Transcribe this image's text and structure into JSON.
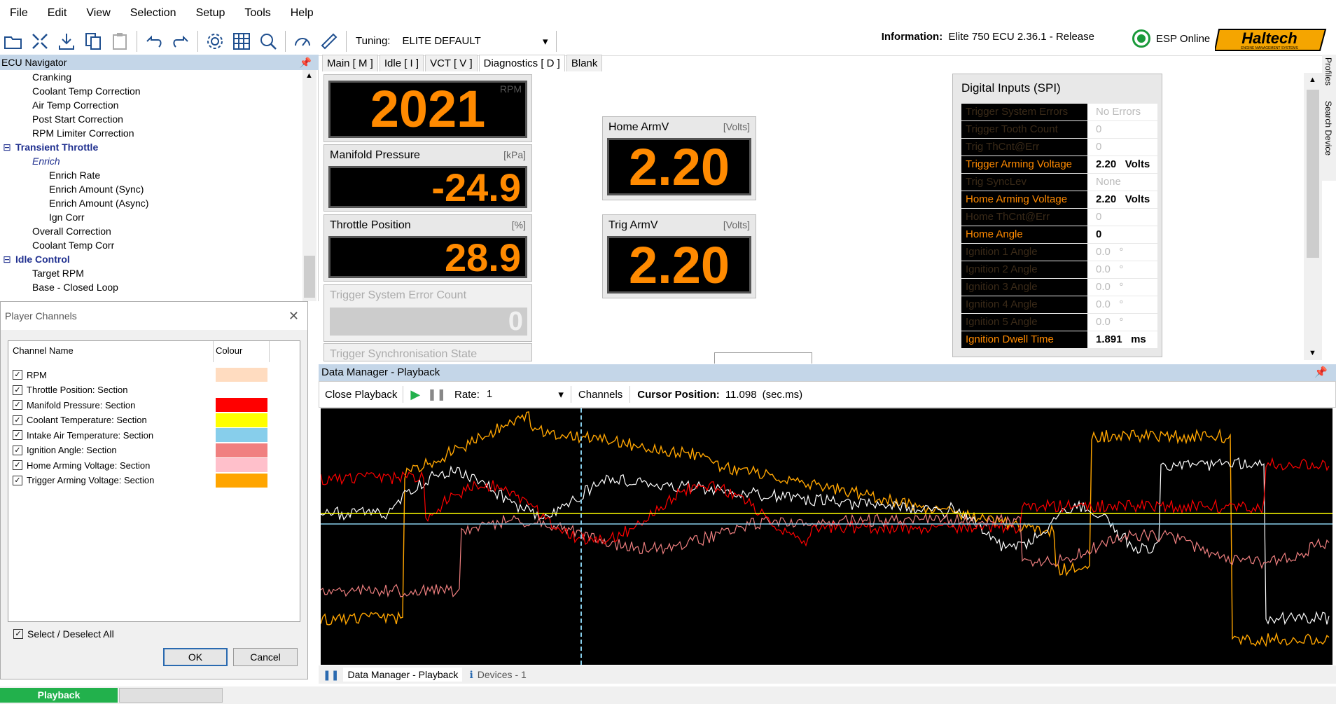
{
  "menu": [
    "File",
    "Edit",
    "View",
    "Selection",
    "Setup",
    "Tools",
    "Help"
  ],
  "toolbar": {
    "tuning_label": "Tuning:",
    "tuning_value": "ELITE DEFAULT"
  },
  "info": {
    "label": "Information:",
    "value": "Elite 750 ECU 2.36.1 - Release"
  },
  "esp": {
    "label": "ESP Online",
    "color": "#1a9a3a"
  },
  "logo": {
    "text": "Haltech",
    "sub": "ENGINE MANAGEMENT SYSTEMS"
  },
  "navigator": {
    "title": "ECU Navigator",
    "items": [
      {
        "label": "Cranking",
        "style": "normal"
      },
      {
        "label": "Coolant Temp Correction",
        "style": "normal"
      },
      {
        "label": "Air Temp Correction",
        "style": "normal"
      },
      {
        "label": "Post Start Correction",
        "style": "normal"
      },
      {
        "label": "RPM Limiter Correction",
        "style": "normal"
      },
      {
        "label": "Transient Throttle",
        "style": "bold"
      },
      {
        "label": "Enrich",
        "style": "italic"
      },
      {
        "label": "Enrich Rate",
        "style": "normal"
      },
      {
        "label": "Enrich Amount (Sync)",
        "style": "normal"
      },
      {
        "label": "Enrich Amount (Async)",
        "style": "normal"
      },
      {
        "label": "Ign Corr",
        "style": "normal"
      },
      {
        "label": "Overall Correction",
        "style": "normal"
      },
      {
        "label": "Coolant Temp Corr",
        "style": "normal"
      },
      {
        "label": "Idle Control",
        "style": "bold"
      },
      {
        "label": "Target RPM",
        "style": "normal"
      },
      {
        "label": "Base - Closed Loop",
        "style": "normal"
      }
    ]
  },
  "player_channels": {
    "title": "Player Channels",
    "col_name": "Channel Name",
    "col_colour": "Colour",
    "channels": [
      {
        "name": "RPM",
        "color": "#ffdcc0"
      },
      {
        "name": "Throttle Position: Section",
        "color": ""
      },
      {
        "name": "Manifold Pressure: Section",
        "color": "#ff0000"
      },
      {
        "name": "Coolant Temperature: Section",
        "color": "#ffff00"
      },
      {
        "name": "Intake Air Temperature: Section",
        "color": "#87ceeb"
      },
      {
        "name": "Ignition Angle: Section",
        "color": "#f08080"
      },
      {
        "name": "Home Arming Voltage: Section",
        "color": "#ffc0cb"
      },
      {
        "name": "Trigger Arming Voltage: Section",
        "color": "#ffa500"
      }
    ],
    "select_all": "Select / Deselect All",
    "ok": "OK",
    "cancel": "Cancel"
  },
  "tabs": [
    "Main [ M ]",
    "Idle [ I ]",
    "VCT [ V ]",
    "Diagnostics [ D ]",
    "Blank"
  ],
  "gauges": {
    "rpm": {
      "unit": "RPM",
      "value": "2021"
    },
    "map": {
      "title": "Manifold Pressure",
      "unit": "[kPa]",
      "value": "-24.9"
    },
    "tps": {
      "title": "Throttle Position",
      "unit": "[%]",
      "value": "28.9"
    },
    "tsec": {
      "title": "Trigger System Error Count",
      "value": "0"
    },
    "tss": {
      "title": "Trigger Synchronisation State"
    },
    "home": {
      "title": "Home ArmV",
      "unit": "[Volts]",
      "value": "2.20"
    },
    "trig": {
      "title": "Trig ArmV",
      "unit": "[Volts]",
      "value": "2.20"
    }
  },
  "digital_inputs": {
    "title": "Digital Inputs (SPI)",
    "rows": [
      {
        "label": "Trigger System Errors",
        "value": "No Errors",
        "unit": "",
        "active": false
      },
      {
        "label": "Trigger Tooth Count",
        "value": "0",
        "unit": "",
        "active": false
      },
      {
        "label": "Trig ThCnt@Err",
        "value": "0",
        "unit": "",
        "active": false
      },
      {
        "label": "Trigger Arming Voltage",
        "value": "2.20",
        "unit": "Volts",
        "active": true
      },
      {
        "label": "Trig SyncLev",
        "value": "None",
        "unit": "",
        "active": false
      },
      {
        "label": "Home Arming Voltage",
        "value": "2.20",
        "unit": "Volts",
        "active": true
      },
      {
        "label": "Home ThCnt@Err",
        "value": "0",
        "unit": "",
        "active": false
      },
      {
        "label": "Home Angle",
        "value": "0",
        "unit": "",
        "active": true
      },
      {
        "label": "Ignition 1 Angle",
        "value": "0.0",
        "unit": "°",
        "active": false
      },
      {
        "label": "Ignition 2 Angle",
        "value": "0.0",
        "unit": "°",
        "active": false
      },
      {
        "label": "Ignition 3 Angle",
        "value": "0.0",
        "unit": "°",
        "active": false
      },
      {
        "label": "Ignition 4 Angle",
        "value": "0.0",
        "unit": "°",
        "active": false
      },
      {
        "label": "Ignition 5 Angle",
        "value": "0.0",
        "unit": "°",
        "active": false
      },
      {
        "label": "Ignition Dwell Time",
        "value": "1.891",
        "unit": "ms",
        "active": true
      }
    ]
  },
  "data_manager": {
    "title": "Data Manager - Playback",
    "close": "Close Playback",
    "rate_label": "Rate:",
    "rate_value": "1",
    "channels": "Channels",
    "cursor_label": "Cursor Position:",
    "cursor_value": "11.098",
    "cursor_unit": "(sec.ms)",
    "tab1": "Data Manager - Playback",
    "tab2": "Devices - 1"
  },
  "side_tabs": [
    "Profiles",
    "Search Device"
  ],
  "status": {
    "playback": "Playback"
  }
}
